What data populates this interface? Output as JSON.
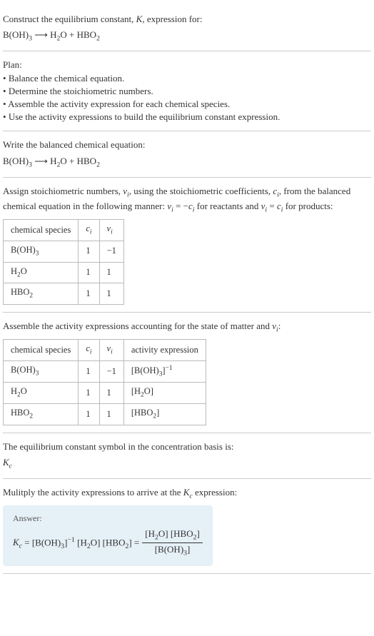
{
  "s1": {
    "line1": "Construct the equilibrium constant, K, expression for:",
    "eq": "B(OH)₃ ⟶ H₂O + HBO₂"
  },
  "s2": {
    "title": "Plan:",
    "items": [
      "Balance the chemical equation.",
      "Determine the stoichiometric numbers.",
      "Assemble the activity expression for each chemical species.",
      "Use the activity expressions to build the equilibrium constant expression."
    ]
  },
  "s3": {
    "title": "Write the balanced chemical equation:",
    "eq": "B(OH)₃ ⟶ H₂O + HBO₂"
  },
  "s4": {
    "text": "Assign stoichiometric numbers, νᵢ, using the stoichiometric coefficients, cᵢ, from the balanced chemical equation in the following manner: νᵢ = −cᵢ for reactants and νᵢ = cᵢ for products:",
    "headers": [
      "chemical species",
      "cᵢ",
      "νᵢ"
    ],
    "rows": [
      [
        "B(OH)₃",
        "1",
        "−1"
      ],
      [
        "H₂O",
        "1",
        "1"
      ],
      [
        "HBO₂",
        "1",
        "1"
      ]
    ]
  },
  "s5": {
    "text": "Assemble the activity expressions accounting for the state of matter and νᵢ:",
    "headers": [
      "chemical species",
      "cᵢ",
      "νᵢ",
      "activity expression"
    ],
    "rows": [
      [
        "B(OH)₃",
        "1",
        "−1",
        "[B(OH)₃]⁻¹"
      ],
      [
        "H₂O",
        "1",
        "1",
        "[H₂O]"
      ],
      [
        "HBO₂",
        "1",
        "1",
        "[HBO₂]"
      ]
    ]
  },
  "s6": {
    "text": "The equilibrium constant symbol in the concentration basis is:",
    "symbol": "K_c"
  },
  "s7": {
    "text": "Mulitply the activity expressions to arrive at the K_c expression:",
    "answer_label": "Answer:",
    "lhs": "K_c = [B(OH)₃]⁻¹ [H₂O] [HBO₂] =",
    "num": "[H₂O] [HBO₂]",
    "den": "[B(OH)₃]"
  }
}
